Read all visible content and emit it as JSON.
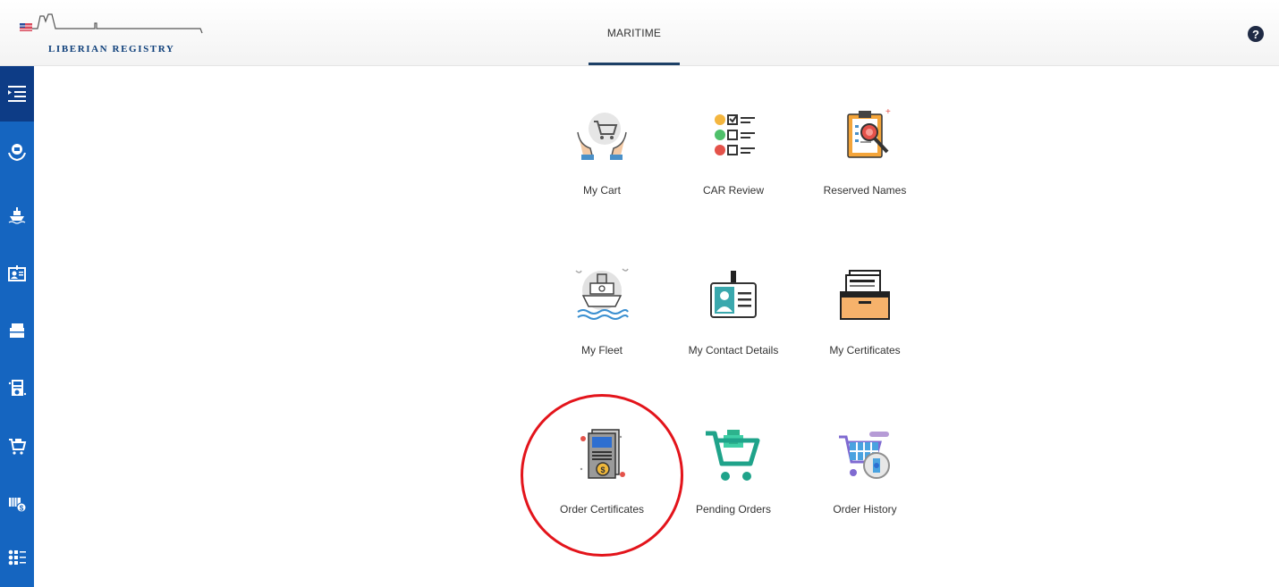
{
  "header": {
    "logo_text": "LIBERIAN REGISTRY",
    "nav_tab": "MARITIME",
    "help_icon": "question-circle-icon"
  },
  "sidebar": {
    "items": [
      {
        "icon": "menu-expand-icon"
      },
      {
        "icon": "helping-hands-icon"
      },
      {
        "icon": "ship-icon"
      },
      {
        "icon": "contact-card-icon"
      },
      {
        "icon": "folder-icon"
      },
      {
        "icon": "document-form-icon"
      },
      {
        "icon": "cart-icon"
      },
      {
        "icon": "cart-dollar-icon"
      },
      {
        "icon": "checklist-icon"
      }
    ]
  },
  "tiles": [
    {
      "label": "My Cart",
      "icon": "hands-cart-icon"
    },
    {
      "label": "CAR Review",
      "icon": "checklist-faces-icon"
    },
    {
      "label": "Reserved Names",
      "icon": "clipboard-magnifier-icon"
    },
    {
      "label": "My Fleet",
      "icon": "ship-waves-icon"
    },
    {
      "label": "My Contact Details",
      "icon": "id-badge-icon"
    },
    {
      "label": "My Certificates",
      "icon": "file-folder-icon"
    },
    {
      "label": "Order Certificates",
      "icon": "certificate-coin-icon"
    },
    {
      "label": "Pending Orders",
      "icon": "cart-money-icon"
    },
    {
      "label": "Order History",
      "icon": "cart-clock-icon"
    }
  ],
  "colors": {
    "sidebar": "#1565c0",
    "sidebar_active": "#0d3c86",
    "nav_underline": "#1c3f66",
    "highlight": "#e3141b"
  }
}
